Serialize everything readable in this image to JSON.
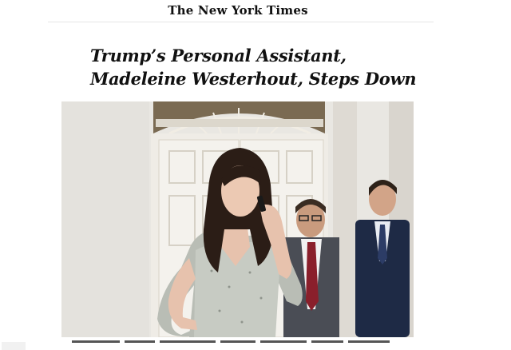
{
  "masthead": {
    "title": "The New York Times"
  },
  "article": {
    "headline_line1": "Trump’s Personal Assistant,",
    "headline_line2": "Madeleine Westerhout, Steps Down"
  },
  "colors": {
    "text": "#111111",
    "background": "#ffffff",
    "rule": "#e6e6e6"
  }
}
